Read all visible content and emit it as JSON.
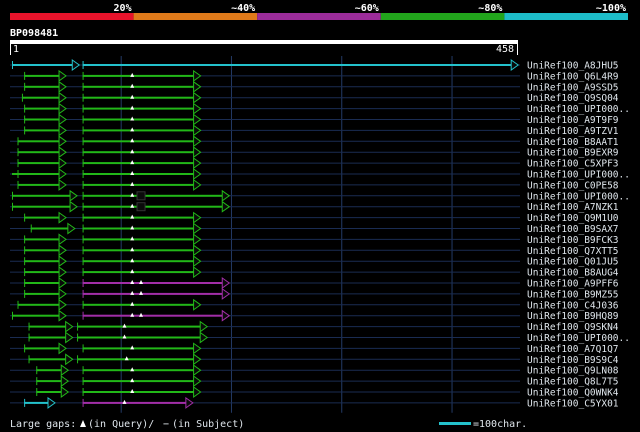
{
  "header": {
    "segments": [
      {
        "label": "20%",
        "color": "#e8132b"
      },
      {
        "label": "~40%",
        "color": "#e07a1a"
      },
      {
        "label": "~60%",
        "color": "#9b2c9a"
      },
      {
        "label": "~80%",
        "color": "#22a51c"
      },
      {
        "label": "~100%",
        "color": "#1dbcc8"
      }
    ]
  },
  "query": {
    "name": "BP098481",
    "start": "1",
    "end": "458"
  },
  "colors": {
    "green": "#22b818",
    "magenta": "#a22ea8",
    "cyan": "#24c2cc",
    "label": "#dfe6ec",
    "grid": "#233a66"
  },
  "hits": [
    {
      "label": "UniRef100_A8JHU5",
      "segs": [
        [
          1,
          62,
          "cyan",
          "arrow"
        ],
        [
          65,
          460,
          "cyan",
          "arrow"
        ]
      ],
      "marks": []
    },
    {
      "label": "UniRef100_Q6L4R9",
      "segs": [
        [
          12,
          50,
          "green",
          "arrow"
        ],
        [
          65,
          172,
          "green",
          "arrow"
        ]
      ],
      "marks": [
        110
      ]
    },
    {
      "label": "UniRef100_A9SSD5",
      "segs": [
        [
          12,
          50,
          "green",
          "arrow"
        ],
        [
          65,
          172,
          "green",
          "arrow"
        ]
      ],
      "marks": [
        110
      ]
    },
    {
      "label": "UniRef100_Q9SQ04",
      "segs": [
        [
          10,
          50,
          "green",
          "arrow"
        ],
        [
          65,
          172,
          "green",
          "arrow"
        ]
      ],
      "marks": [
        110
      ]
    },
    {
      "label": "UniRef100_UPI000..",
      "segs": [
        [
          12,
          50,
          "green",
          "arrow"
        ],
        [
          65,
          172,
          "green",
          "arrow"
        ]
      ],
      "marks": [
        110
      ]
    },
    {
      "label": "UniRef100_A9T9F9",
      "segs": [
        [
          12,
          50,
          "green",
          "arrow"
        ],
        [
          65,
          172,
          "green",
          "arrow"
        ]
      ],
      "marks": [
        110
      ]
    },
    {
      "label": "UniRef100_A9TZV1",
      "segs": [
        [
          12,
          50,
          "green",
          "arrow"
        ],
        [
          65,
          172,
          "green",
          "arrow"
        ]
      ],
      "marks": [
        110
      ]
    },
    {
      "label": "UniRef100_B8AAT1",
      "segs": [
        [
          6,
          50,
          "green",
          "arrow"
        ],
        [
          65,
          172,
          "green",
          "arrow"
        ]
      ],
      "marks": [
        110
      ]
    },
    {
      "label": "UniRef100_B9EXR9",
      "segs": [
        [
          6,
          50,
          "green",
          "arrow"
        ],
        [
          65,
          172,
          "green",
          "arrow"
        ]
      ],
      "marks": [
        110
      ]
    },
    {
      "label": "UniRef100_C5XPF3",
      "segs": [
        [
          6,
          50,
          "green",
          "arrow"
        ],
        [
          65,
          172,
          "green",
          "arrow"
        ]
      ],
      "marks": [
        110
      ]
    },
    {
      "label": "UniRef100_UPI000..",
      "segs": [
        [
          1,
          6,
          "green",
          "bar"
        ],
        [
          6,
          50,
          "green",
          "arrow"
        ],
        [
          65,
          172,
          "green",
          "arrow"
        ]
      ],
      "marks": [
        110
      ]
    },
    {
      "label": "UniRef100_C0PE58",
      "segs": [
        [
          6,
          50,
          "green",
          "arrow"
        ],
        [
          65,
          172,
          "green",
          "arrow"
        ]
      ],
      "marks": [
        110
      ]
    },
    {
      "label": "UniRef100_UPI000..",
      "segs": [
        [
          1,
          60,
          "green",
          "arrow"
        ],
        [
          65,
          198,
          "green",
          "arrow"
        ]
      ],
      "marks": [
        110
      ],
      "gapbox": 118
    },
    {
      "label": "UniRef100_A7NZK1",
      "segs": [
        [
          1,
          60,
          "green",
          "arrow"
        ],
        [
          65,
          198,
          "green",
          "arrow"
        ]
      ],
      "marks": [
        110
      ],
      "gapbox": 118
    },
    {
      "label": "UniRef100_Q9M1U0",
      "segs": [
        [
          12,
          50,
          "green",
          "arrow"
        ],
        [
          65,
          172,
          "green",
          "arrow"
        ]
      ],
      "marks": [
        110
      ]
    },
    {
      "label": "UniRef100_B9SAX7",
      "segs": [
        [
          18,
          58,
          "green",
          "arrow"
        ],
        [
          65,
          172,
          "green",
          "arrow"
        ]
      ],
      "marks": [
        110
      ]
    },
    {
      "label": "UniRef100_B9FCK3",
      "segs": [
        [
          12,
          50,
          "green",
          "arrow"
        ],
        [
          65,
          172,
          "green",
          "arrow"
        ]
      ],
      "marks": [
        110
      ]
    },
    {
      "label": "UniRef100_Q7XTT5",
      "segs": [
        [
          12,
          50,
          "green",
          "arrow"
        ],
        [
          65,
          172,
          "green",
          "arrow"
        ]
      ],
      "marks": [
        110
      ]
    },
    {
      "label": "UniRef100_Q01JU5",
      "segs": [
        [
          12,
          50,
          "green",
          "arrow"
        ],
        [
          65,
          172,
          "green",
          "arrow"
        ]
      ],
      "marks": [
        110
      ]
    },
    {
      "label": "UniRef100_B8AUG4",
      "segs": [
        [
          12,
          50,
          "green",
          "arrow"
        ],
        [
          65,
          172,
          "green",
          "arrow"
        ]
      ],
      "marks": [
        110
      ]
    },
    {
      "label": "UniRef100_A9PFF6",
      "segs": [
        [
          12,
          50,
          "green",
          "arrow"
        ],
        [
          65,
          198,
          "magenta",
          "arrow"
        ]
      ],
      "marks": [
        110,
        118
      ]
    },
    {
      "label": "UniRef100_B9MZ55",
      "segs": [
        [
          12,
          50,
          "green",
          "arrow"
        ],
        [
          65,
          198,
          "magenta",
          "arrow"
        ]
      ],
      "marks": [
        110,
        118
      ]
    },
    {
      "label": "UniRef100_C4J036",
      "segs": [
        [
          6,
          50,
          "green",
          "arrow"
        ],
        [
          65,
          172,
          "green",
          "arrow"
        ]
      ],
      "marks": [
        110
      ]
    },
    {
      "label": "UniRef100_B9HQ89",
      "segs": [
        [
          1,
          50,
          "green",
          "arrow"
        ],
        [
          65,
          198,
          "magenta",
          "arrow"
        ]
      ],
      "marks": [
        110,
        118
      ]
    },
    {
      "label": "UniRef100_Q9SKN4",
      "segs": [
        [
          16,
          56,
          "green",
          "arrow"
        ],
        [
          60,
          178,
          "green",
          "arrow"
        ]
      ],
      "marks": [
        103
      ]
    },
    {
      "label": "UniRef100_UPI000..",
      "segs": [
        [
          16,
          56,
          "green",
          "arrow"
        ],
        [
          60,
          178,
          "green",
          "arrow"
        ]
      ],
      "marks": [
        103
      ]
    },
    {
      "label": "UniRef100_A7Q1Q7",
      "segs": [
        [
          12,
          50,
          "green",
          "arrow"
        ],
        [
          65,
          172,
          "green",
          "arrow"
        ]
      ],
      "marks": [
        110
      ]
    },
    {
      "label": "UniRef100_B9S9C4",
      "segs": [
        [
          16,
          56,
          "green",
          "arrow"
        ],
        [
          60,
          172,
          "green",
          "arrow"
        ]
      ],
      "marks": [
        105
      ]
    },
    {
      "label": "UniRef100_Q9LN08",
      "segs": [
        [
          23,
          52,
          "green",
          "arrow"
        ],
        [
          65,
          172,
          "green",
          "arrow"
        ]
      ],
      "marks": [
        110
      ]
    },
    {
      "label": "UniRef100_Q8L7T5",
      "segs": [
        [
          23,
          52,
          "green",
          "arrow"
        ],
        [
          65,
          172,
          "green",
          "arrow"
        ]
      ],
      "marks": [
        110
      ]
    },
    {
      "label": "UniRef100_Q0WNK4",
      "segs": [
        [
          23,
          52,
          "green",
          "arrow"
        ],
        [
          65,
          172,
          "green",
          "arrow"
        ]
      ],
      "marks": [
        110
      ]
    },
    {
      "label": "UniRef100_C5YX01",
      "segs": [
        [
          12,
          40,
          "cyan",
          "arrow"
        ],
        [
          65,
          165,
          "magenta",
          "arrow"
        ]
      ],
      "marks": [
        103
      ]
    }
  ],
  "footer": {
    "gaps_prefix": "Large gaps:",
    "in_query": "(in Query)/",
    "dash": "−",
    "in_subject": "(in Subject)",
    "scale": "=100char."
  }
}
